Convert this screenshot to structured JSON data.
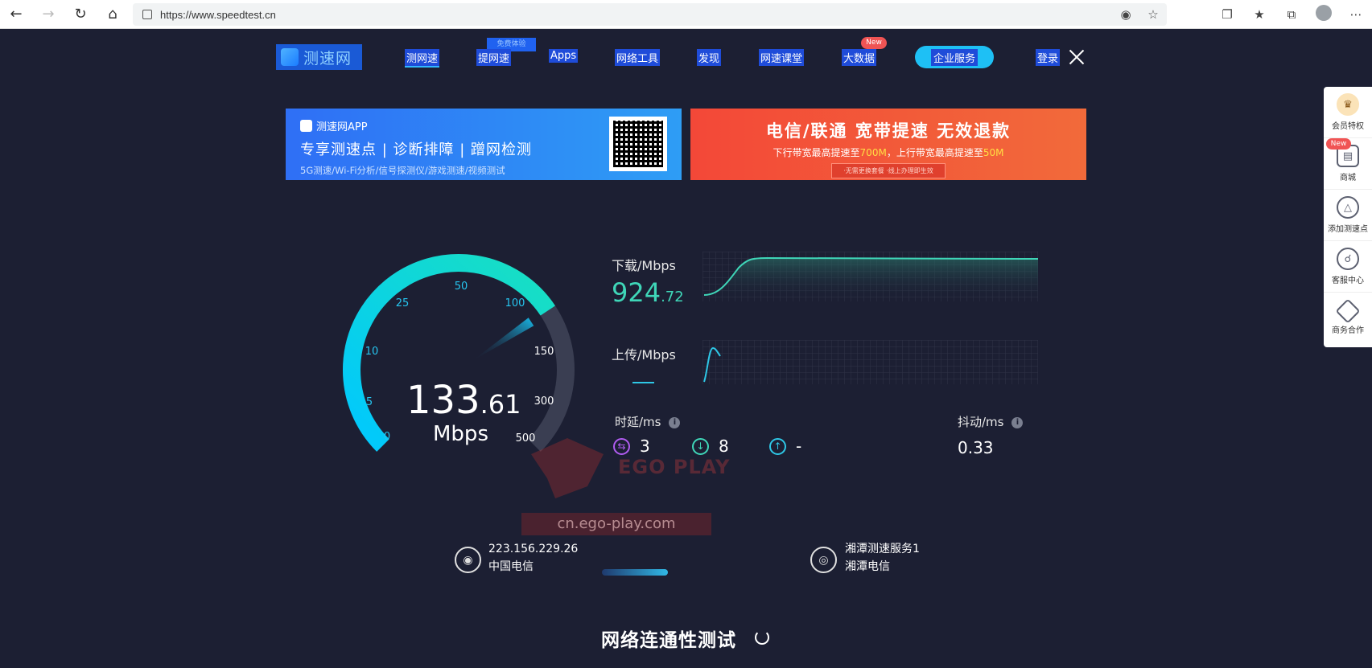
{
  "browser": {
    "url": "https://www.speedtest.cn"
  },
  "header": {
    "logo_text": "测速网",
    "menu": [
      "测网速",
      "提网速",
      "Apps",
      "网络工具",
      "发现",
      "网速课堂",
      "大数据"
    ],
    "free_tag": "免费体验",
    "new_tag": "New",
    "enterprise_label": "企业服务",
    "login_label": "登录"
  },
  "banners": {
    "app_title": "测速网APP",
    "app_headline": "专享测速点 | 诊断排障 | 蹭网检测",
    "app_sub": "5G测速/Wi-Fi分析/信号探测仪/游戏测速/视频测试",
    "promo_headline": "电信/联通 宽带提速 无效退款",
    "promo_sub_1": "下行带宽最高提速至",
    "promo_down": "700M",
    "promo_sub_2": "，上行带宽最高提速至",
    "promo_up": "50M",
    "promo_note": "·无需更换套餐   ·线上办理即生效"
  },
  "gauge": {
    "ticks": [
      "0",
      "5",
      "10",
      "25",
      "50",
      "100",
      "150",
      "300",
      "500"
    ],
    "speed_int": "133",
    "speed_dec": ".61",
    "unit": "Mbps",
    "value": 133.61
  },
  "stats": {
    "download_label": "下载/Mbps",
    "download_int": "924",
    "download_dec": ".72",
    "upload_label": "上传/Mbps",
    "latency_label": "时延/ms",
    "jitter_label": "抖动/ms",
    "info": "i",
    "ping_idle": "3",
    "ping_down": "8",
    "ping_up": "-",
    "jitter": "0.33"
  },
  "watermark": {
    "brand": "EGO PLAY",
    "url": "cn.ego-play.com"
  },
  "client": {
    "ip": "223.156.229.26",
    "isp": "中国电信"
  },
  "server": {
    "name": "湘潭测速服务1",
    "isp": "湘潭电信"
  },
  "connectivity_title": "网络连通性测试",
  "side_panel": {
    "items": [
      "会员特权",
      "商城",
      "添加测速点",
      "客服中心",
      "商务合作"
    ],
    "new_tag": "New"
  },
  "colors": {
    "background": "#1c1f33",
    "gauge_accent": "#00d4ff",
    "download": "#3fd6b8",
    "upload": "#2ec7e6"
  }
}
